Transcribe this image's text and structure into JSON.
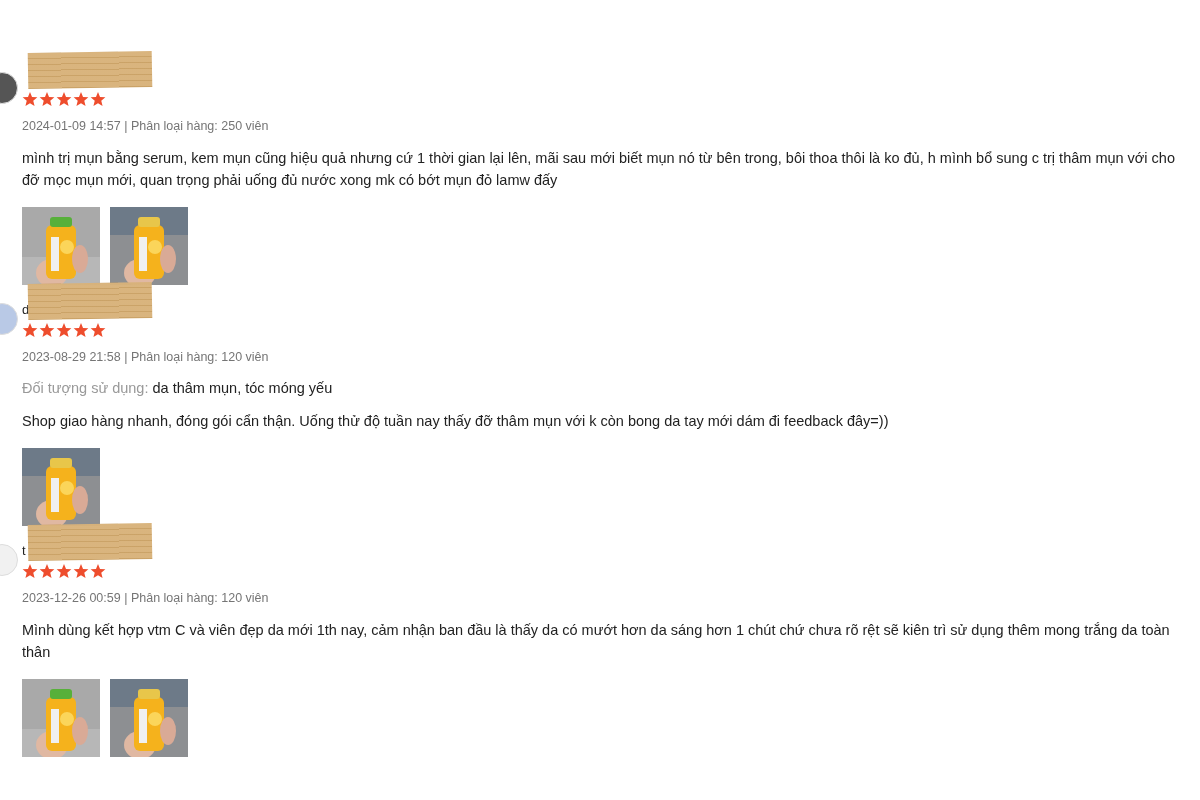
{
  "reviews": [
    {
      "reviewer": {
        "redacted": true
      },
      "stars": 5,
      "meta": "2024-01-09 14:57 | Phân loại hàng: 250 viên",
      "text": "mình trị mụn bằng serum, kem mụn cũng hiệu quả nhưng cứ 1 thời gian lại lên, mãi sau mới biết mụn nó từ bên trong, bôi thoa thôi là ko đủ, h mình bổ sung c trị thâm mụn với  cho đỡ mọc mụn mới, quan trọng phải uống đủ nước xong mk có bớt mụn đỏ lamw đấy",
      "photos": [
        {
          "kind": "picture"
        },
        {
          "kind": "picture"
        }
      ]
    },
    {
      "reviewer": {
        "name": "d",
        "redacted": true
      },
      "stars": 5,
      "meta": "2023-08-29 21:58 | Phân loại hàng: 120 viên",
      "attributes": [
        {
          "label": "Đối tượng sử dụng:",
          "value": "da thâm mụn, tóc móng yếu"
        }
      ],
      "text": "Shop giao hàng nhanh, đóng gói cẩn thận. Uống thử độ tuần nay thấy đỡ thâm mụn với k còn bong da tay mới dám đi feedback đây=))",
      "photos": [
        {
          "kind": "picture"
        }
      ]
    },
    {
      "reviewer": {
        "name": "t",
        "redacted": true
      },
      "stars": 5,
      "meta": "2023-12-26 00:59 | Phân loại hàng: 120 viên",
      "text": "Mình dùng kết hợp vtm C và viên đẹp da mới 1th nay, cảm nhận ban đầu là thấy da có mướt hơn da sáng hơn 1 chút chứ chưa rõ rệt sẽ kiên trì sử dụng thêm mong trắng da toàn thân",
      "photos": [
        {
          "kind": "picture"
        },
        {
          "kind": "picture"
        }
      ]
    }
  ]
}
